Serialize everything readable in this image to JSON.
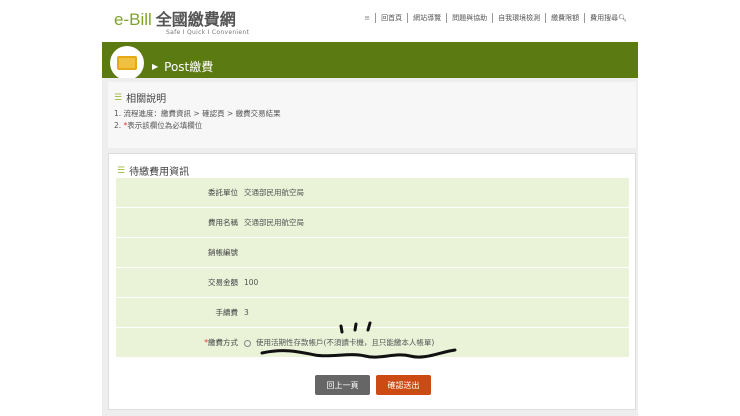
{
  "header": {
    "brand": "e-Bill",
    "brand_cn": "全國繳費網",
    "tagline": "Safe I Quick I Convenient",
    "menu_icon": "≡",
    "nav": [
      "回首頁",
      "網站導覽",
      "問題與協助",
      "自我環境檢測",
      "繳費限額",
      "費用搜尋"
    ]
  },
  "banner": {
    "title": "Post繳費",
    "icon": "money-icon"
  },
  "info": {
    "title": "相關說明",
    "line1": "1. 流程進度：繳費資訊 > 確認頁 > 繳費交易結果",
    "line2_num": "2. ",
    "line2_star": "*",
    "line2": "表示該欄位為必填欄位"
  },
  "card": {
    "title": "待繳費用資訊",
    "rows": [
      {
        "label": "委託單位",
        "value": "交通部民用航空局"
      },
      {
        "label": "費用名稱",
        "value": "交通部民用航空局"
      },
      {
        "label": "銷帳編號",
        "value": ""
      },
      {
        "label": "交易金額",
        "value": "100"
      },
      {
        "label": "手續費",
        "value": "3"
      }
    ],
    "payment": {
      "star": "*",
      "label": "繳費方式",
      "option": "使用活期性存款帳戶(不須讀卡機，且只能繳本人帳單)"
    }
  },
  "buttons": {
    "back": "回上一頁",
    "confirm": "確認送出"
  }
}
